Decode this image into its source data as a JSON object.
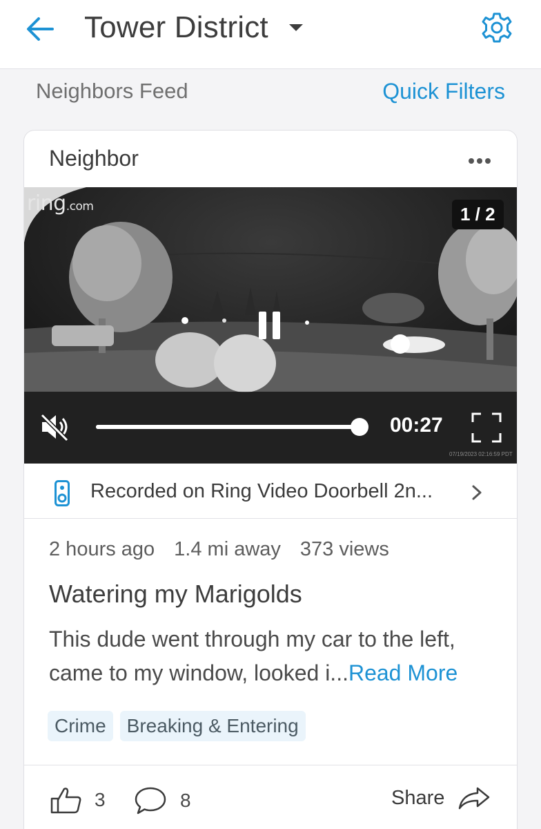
{
  "header": {
    "title": "Tower District",
    "back_icon": "arrow-left-icon",
    "settings_icon": "gear-icon",
    "accent_color": "#1d92d4"
  },
  "feed": {
    "label": "Neighbors Feed",
    "quick_filters": "Quick Filters"
  },
  "post": {
    "source": "Neighbor",
    "video": {
      "watermark_brand": "ring",
      "watermark_suffix": ".com",
      "counter": "1 / 2",
      "time": "00:27",
      "progress_fraction": 0.99,
      "timestamp": "07/19/2023 02:16:59 PDT",
      "muted": true
    },
    "device": "Recorded on Ring Video Doorbell 2n...",
    "meta": {
      "time_ago": "2 hours ago",
      "distance": "1.4 mi away",
      "views": "373 views"
    },
    "title": "Watering my Marigolds",
    "body": "This dude went through my car  to the left, came to my window, looked i...",
    "read_more": "Read More",
    "tags": [
      "Crime",
      "Breaking & Entering"
    ],
    "actions": {
      "likes": "3",
      "comments": "8",
      "share": "Share"
    }
  }
}
